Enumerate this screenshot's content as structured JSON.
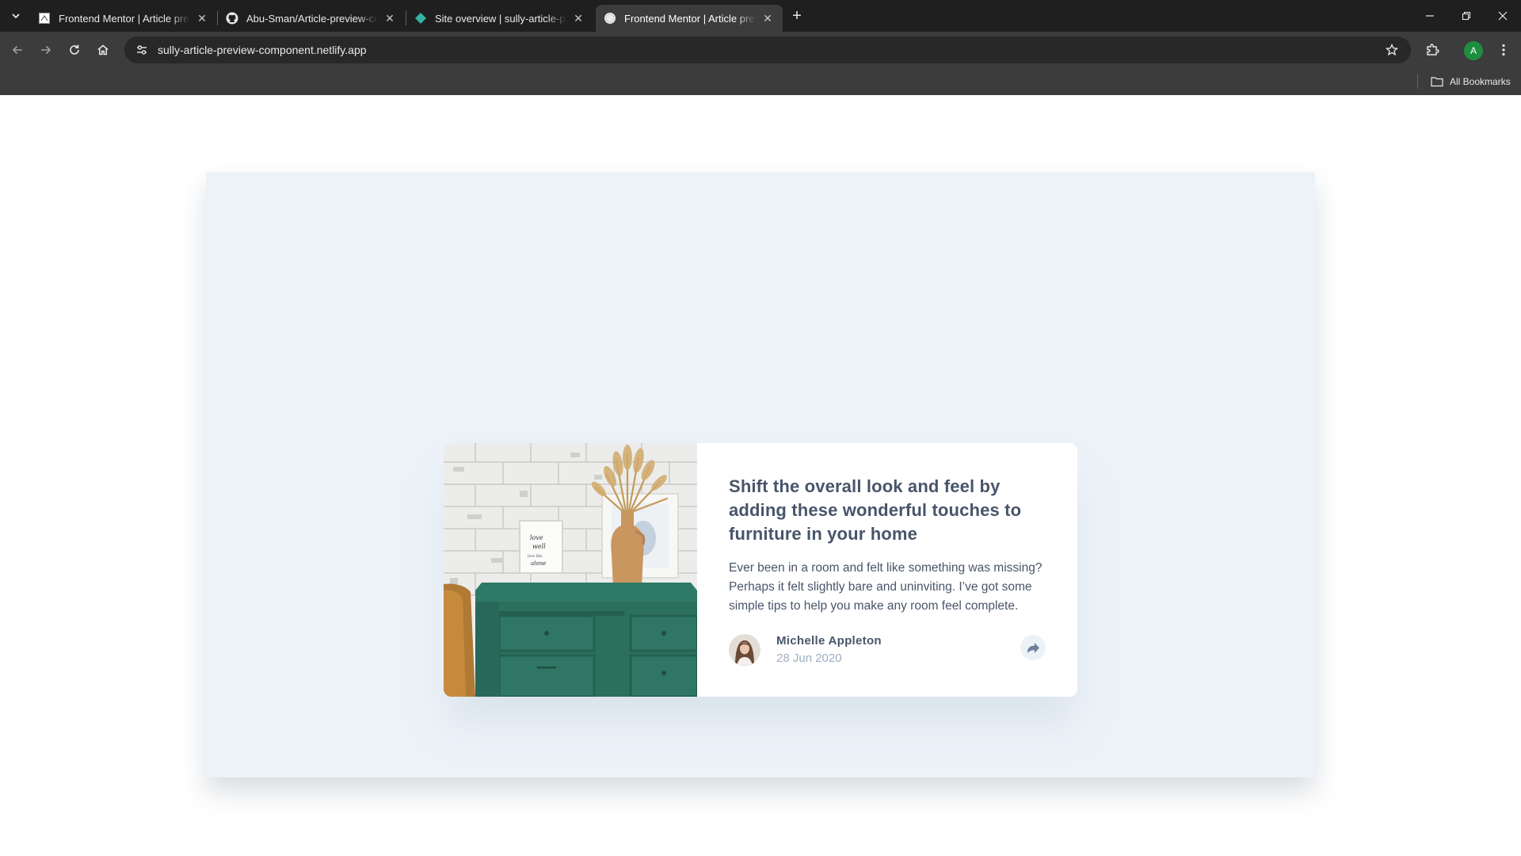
{
  "browser": {
    "tabs": [
      {
        "title": "Frontend Mentor | Article previ",
        "favicon": "frontend-mentor-icon",
        "active": false
      },
      {
        "title": "Abu-Sman/Article-preview-com",
        "favicon": "github-icon",
        "active": false
      },
      {
        "title": "Site overview | sully-article-pre",
        "favicon": "netlify-icon",
        "active": false
      },
      {
        "title": "Frontend Mentor | Article previ",
        "favicon": "globe-icon",
        "active": true
      }
    ],
    "url": "sully-article-preview-component.netlify.app",
    "profile_initial": "A",
    "bookmarks_label": "All Bookmarks"
  },
  "article": {
    "headline": "Shift the overall look and feel by adding these wonderful touches to furniture in your home",
    "excerpt": "Ever been in a room and felt like something was missing? Perhaps it felt slightly bare and uninviting. I’ve got some simple tips to help you make any room feel complete.",
    "author_name": "Michelle Appleton",
    "date": "28 Jun 2020",
    "image_alt": "drawers",
    "avatar_alt": "Michelle Appleton avatar",
    "share_icon": "share-icon"
  },
  "colors": {
    "page_bg": "#ECF2F8",
    "heading": "#48556A",
    "muted": "#9EAFC2",
    "card_bg": "#FFFFFF"
  }
}
